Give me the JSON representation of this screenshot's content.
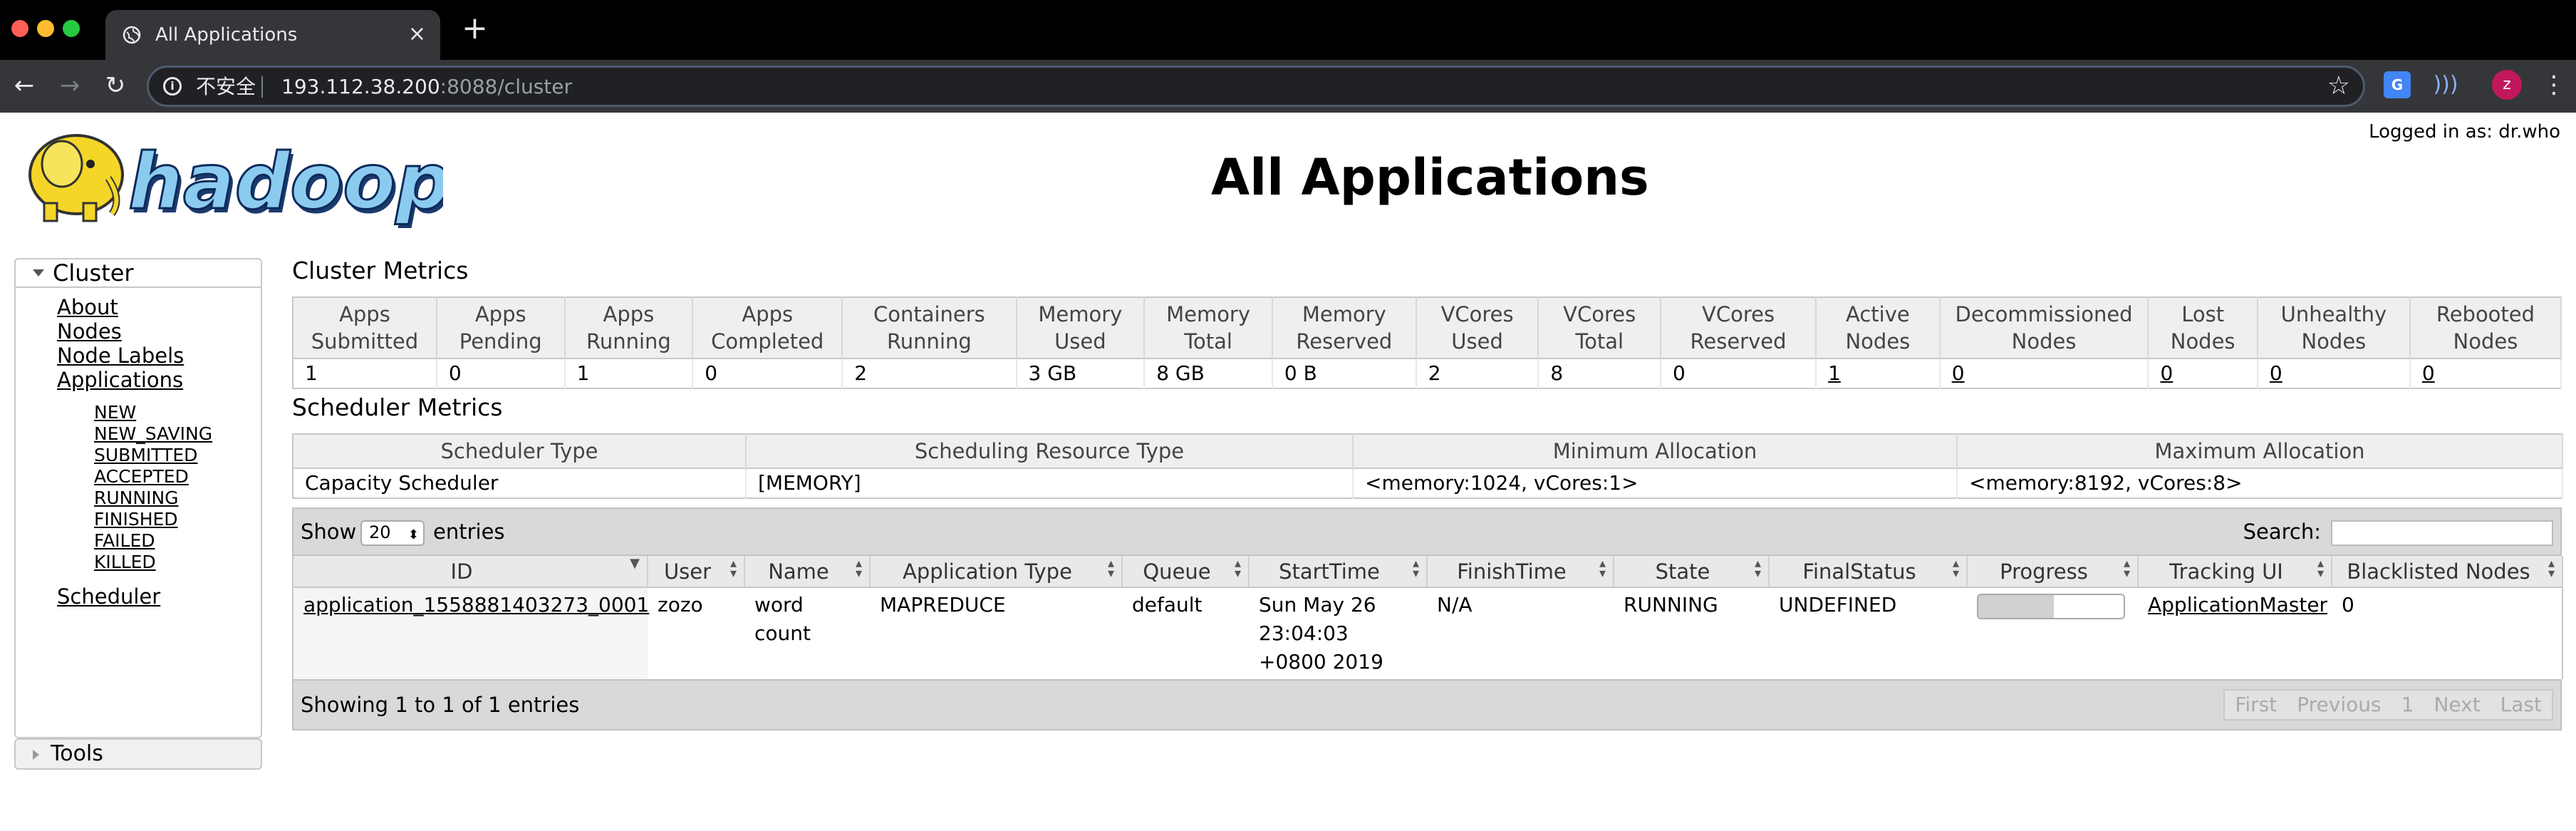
{
  "browser": {
    "tab_title": "All Applications",
    "tab_close": "×",
    "new_tab": "+",
    "insecure_label": "不安全",
    "url_host": "193.112.38.200",
    "url_rest": ":8088/cluster",
    "avatar_letter": "z",
    "translate_label": "G"
  },
  "page": {
    "logged_in": "Logged in as: dr.who",
    "title": "All Applications"
  },
  "sidebar": {
    "cluster_label": "Cluster",
    "links": [
      "About",
      "Nodes",
      "Node Labels",
      "Applications"
    ],
    "app_states": [
      "NEW",
      "NEW_SAVING",
      "SUBMITTED",
      "ACCEPTED",
      "RUNNING",
      "FINISHED",
      "FAILED",
      "KILLED"
    ],
    "scheduler": "Scheduler",
    "tools": "Tools"
  },
  "cluster_metrics": {
    "title": "Cluster Metrics",
    "headers": [
      [
        "Apps",
        "Submitted"
      ],
      [
        "Apps",
        "Pending"
      ],
      [
        "Apps",
        "Running"
      ],
      [
        "Apps",
        "Completed"
      ],
      [
        "Containers",
        "Running"
      ],
      [
        "Memory",
        "Used"
      ],
      [
        "Memory",
        "Total"
      ],
      [
        "Memory",
        "Reserved"
      ],
      [
        "VCores",
        "Used"
      ],
      [
        "VCores",
        "Total"
      ],
      [
        "VCores",
        "Reserved"
      ],
      [
        "Active",
        "Nodes"
      ],
      [
        "Decommissioned",
        "Nodes"
      ],
      [
        "Lost",
        "Nodes"
      ],
      [
        "Unhealthy",
        "Nodes"
      ],
      [
        "Rebooted",
        "Nodes"
      ]
    ],
    "values": [
      "1",
      "0",
      "1",
      "0",
      "2",
      "3 GB",
      "8 GB",
      "0 B",
      "2",
      "8",
      "0",
      "1",
      "0",
      "0",
      "0",
      "0"
    ]
  },
  "scheduler_metrics": {
    "title": "Scheduler Metrics",
    "headers": [
      "Scheduler Type",
      "Scheduling Resource Type",
      "Minimum Allocation",
      "Maximum Allocation"
    ],
    "values": [
      "Capacity Scheduler",
      "[MEMORY]",
      "<memory:1024, vCores:1>",
      "<memory:8192, vCores:8>"
    ]
  },
  "apps_table": {
    "show_label": "Show",
    "page_size": "20",
    "entries_label": "entries",
    "search_label": "Search:",
    "search_value": "",
    "headers": [
      "ID",
      "User",
      "Name",
      "Application Type",
      "Queue",
      "StartTime",
      "FinishTime",
      "State",
      "FinalStatus",
      "Progress",
      "Tracking UI",
      "Blacklisted Nodes"
    ],
    "rows": [
      {
        "id": "application_1558881403273_0001",
        "user": "zozo",
        "name": "word count",
        "type": "MAPREDUCE",
        "queue": "default",
        "start": "Sun May 26 23:04:03 +0800 2019",
        "finish": "N/A",
        "state": "RUNNING",
        "final_status": "UNDEFINED",
        "progress": 0.52,
        "tracking_ui": "ApplicationMaster",
        "blacklisted": "0"
      }
    ],
    "showing": "Showing 1 to 1 of 1 entries",
    "pager": [
      "First",
      "Previous",
      "1",
      "Next",
      "Last"
    ]
  }
}
